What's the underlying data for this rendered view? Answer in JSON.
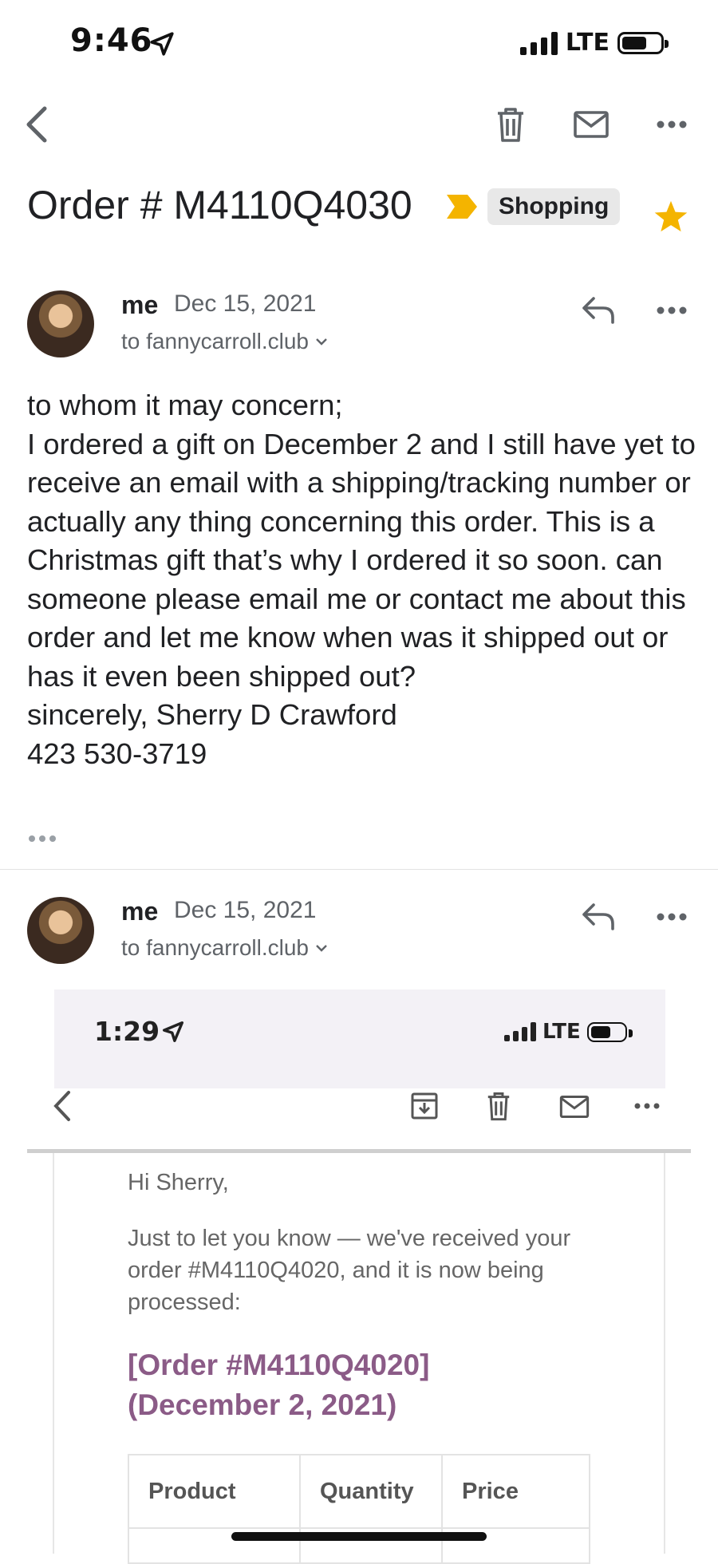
{
  "status_bar": {
    "time": "9:46",
    "network": "LTE"
  },
  "toolbar": {
    "back_icon": "chevron-left-icon",
    "delete_icon": "trash-icon",
    "mark_unread_icon": "mail-icon",
    "more_icon": "more-horizontal-icon"
  },
  "email": {
    "subject": "Order # M4110Q4030",
    "label": "Shopping",
    "starred": true,
    "accent_color": "#f4b400"
  },
  "messages": [
    {
      "sender": "me",
      "date": "Dec 15, 2021",
      "to": "to fannycarroll.club",
      "body": "to whom it may concern;\nI ordered a gift on December 2 and I still have yet to receive an email with a shipping/tracking number or actually any thing concerning this order. This is a Christmas gift that’s why I ordered it so soon. can someone please email me or contact me about this order and let me know when was it shipped out or has it even been shipped out?\nsincerely, Sherry D Crawford\n423 530-3719"
    },
    {
      "sender": "me",
      "date": "Dec 15, 2021",
      "to": "to fannycarroll.club"
    }
  ],
  "attachment_screenshot": {
    "time": "1:29",
    "network": "LTE",
    "greeting": "Hi Sherry,",
    "message": "Just to let you know — we've received your order #M4110Q4020, and it is now being processed:",
    "order_heading_line1": "[Order #M4110Q4020]",
    "order_heading_line2": "(December 2, 2021)",
    "order_color": "#8b5b87",
    "table_headers": [
      "Product",
      "Quantity",
      "Price"
    ]
  }
}
